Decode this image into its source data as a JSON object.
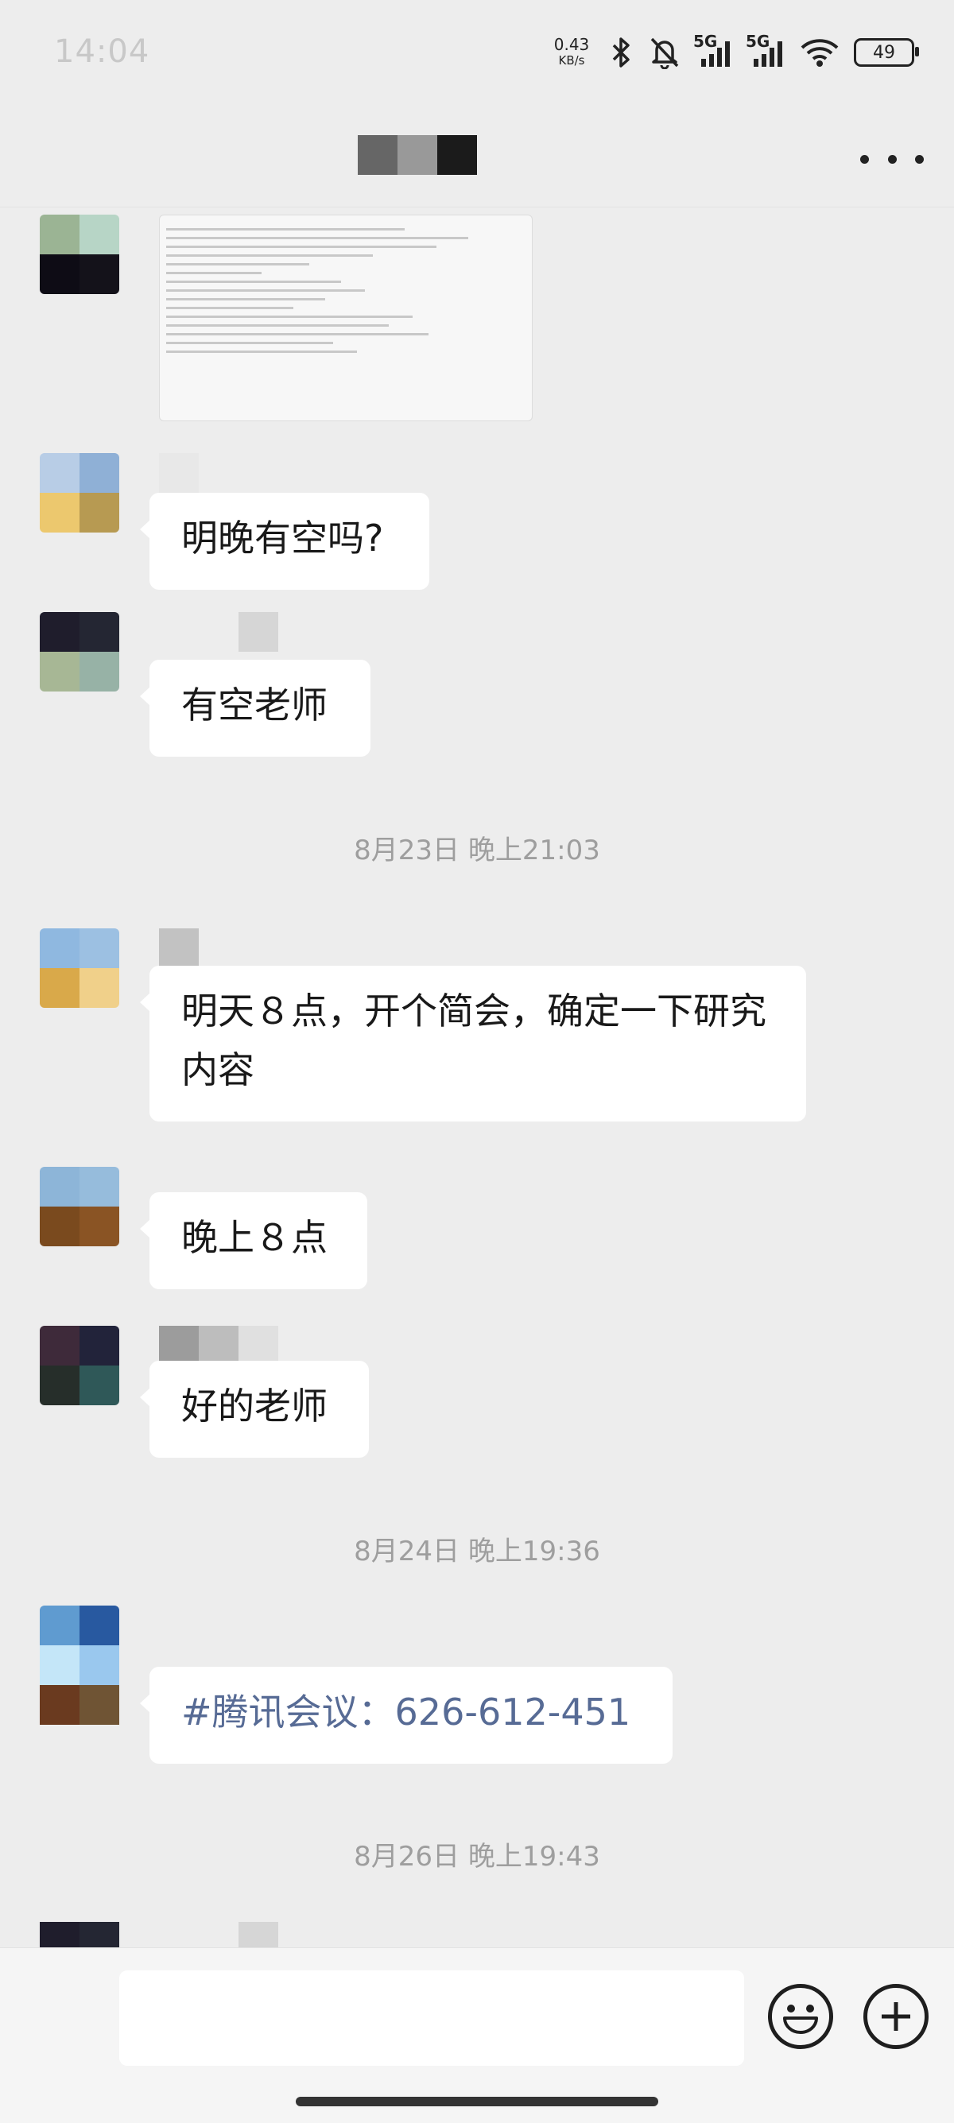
{
  "status_bar": {
    "time": "14:04",
    "net_speed_value": "0.43",
    "net_speed_unit": "KB/s",
    "signal_1": "5G",
    "signal_2": "5G",
    "battery": "49"
  },
  "header": {
    "title_redacted": true,
    "more_icon": "more-dots-icon"
  },
  "messages": [
    {
      "type": "image",
      "content_icon": "document-screenshot"
    },
    {
      "type": "text",
      "text": "明晚有空吗?"
    },
    {
      "type": "text",
      "text": "有空老师"
    },
    {
      "type": "timestamp",
      "text": "8月23日 晚上21:03"
    },
    {
      "type": "text",
      "text": "明天８点，开个简会，确定一下研究内容"
    },
    {
      "type": "text",
      "text": "晚上８点"
    },
    {
      "type": "text",
      "text": "好的老师"
    },
    {
      "type": "timestamp",
      "text": "8月24日 晚上19:36"
    },
    {
      "type": "link",
      "text": "#腾讯会议：626-612-451"
    },
    {
      "type": "timestamp",
      "text": "8月26日 晚上19:43"
    }
  ],
  "input_bar": {
    "emoji_icon": "emoji-icon",
    "plus_icon": "plus-icon"
  },
  "colors": {
    "background": "#ededed",
    "bubble": "#ffffff",
    "link": "#576b95",
    "timestamp": "#9e9e9e"
  }
}
